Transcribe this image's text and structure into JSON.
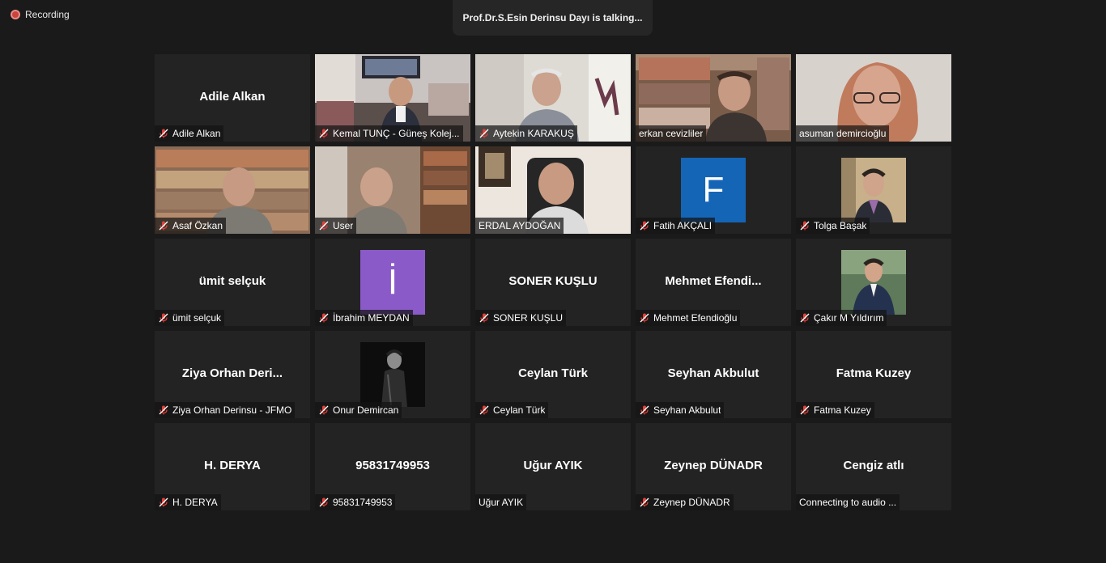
{
  "recording": {
    "label": "Recording"
  },
  "speaker": {
    "text": "Prof.Dr.S.Esin Derinsu Dayı is talking..."
  },
  "tiles": [
    {
      "center": "Adile Alkan",
      "label": "Adile Alkan",
      "muted": true
    },
    {
      "label": "Kemal TUNÇ - Güneş Kolej...",
      "muted": true
    },
    {
      "label": "Aytekin KARAKUŞ",
      "muted": true
    },
    {
      "label": "erkan cevizliler",
      "muted": false
    },
    {
      "label": "asuman demircioğlu",
      "muted": false
    },
    {
      "label": "Asaf Özkan",
      "muted": true
    },
    {
      "label": "User",
      "muted": true
    },
    {
      "label": "ERDAL AYDOĞAN",
      "muted": false
    },
    {
      "avatar_letter": "F",
      "label": "Fatih AKÇALI",
      "muted": true
    },
    {
      "label": "Tolga Başak",
      "muted": true
    },
    {
      "center": "ümit selçuk",
      "label": "ümit selçuk",
      "muted": true
    },
    {
      "avatar_letter": "İ",
      "label": "İbrahim MEYDAN",
      "muted": true
    },
    {
      "center": "SONER KUŞLU",
      "label": "SONER KUŞLU",
      "muted": true
    },
    {
      "center": "Mehmet  Efendi...",
      "label": "Mehmet Efendioğlu",
      "muted": true
    },
    {
      "label": "Çakır M Yıldırım",
      "muted": true
    },
    {
      "center": "Ziya  Orhan  Deri...",
      "label": "Ziya Orhan Derinsu - JFMO",
      "muted": true
    },
    {
      "label": "Onur Demircan",
      "muted": true
    },
    {
      "center": "Ceylan Türk",
      "label": "Ceylan Türk",
      "muted": true
    },
    {
      "center": "Seyhan Akbulut",
      "label": "Seyhan Akbulut",
      "muted": true
    },
    {
      "center": "Fatma Kuzey",
      "label": "Fatma Kuzey",
      "muted": true
    },
    {
      "center": "H. DERYA",
      "label": "H. DERYA",
      "muted": true
    },
    {
      "center": "95831749953",
      "label": "95831749953",
      "muted": true
    },
    {
      "center": "Uğur AYIK",
      "label": "Uğur AYIK",
      "muted": false
    },
    {
      "center": "Zeynep DÜNADR",
      "label": "Zeynep DÜNADR",
      "muted": true
    },
    {
      "center": "Cengiz atlı",
      "label": "Connecting to audio ...",
      "muted": false
    }
  ],
  "colors": {
    "background": "#1a1a1a",
    "tile": "#232323",
    "muted_icon": "#e0403a",
    "avatar_f": "#1565b7",
    "avatar_i": "#8a5ac8"
  }
}
